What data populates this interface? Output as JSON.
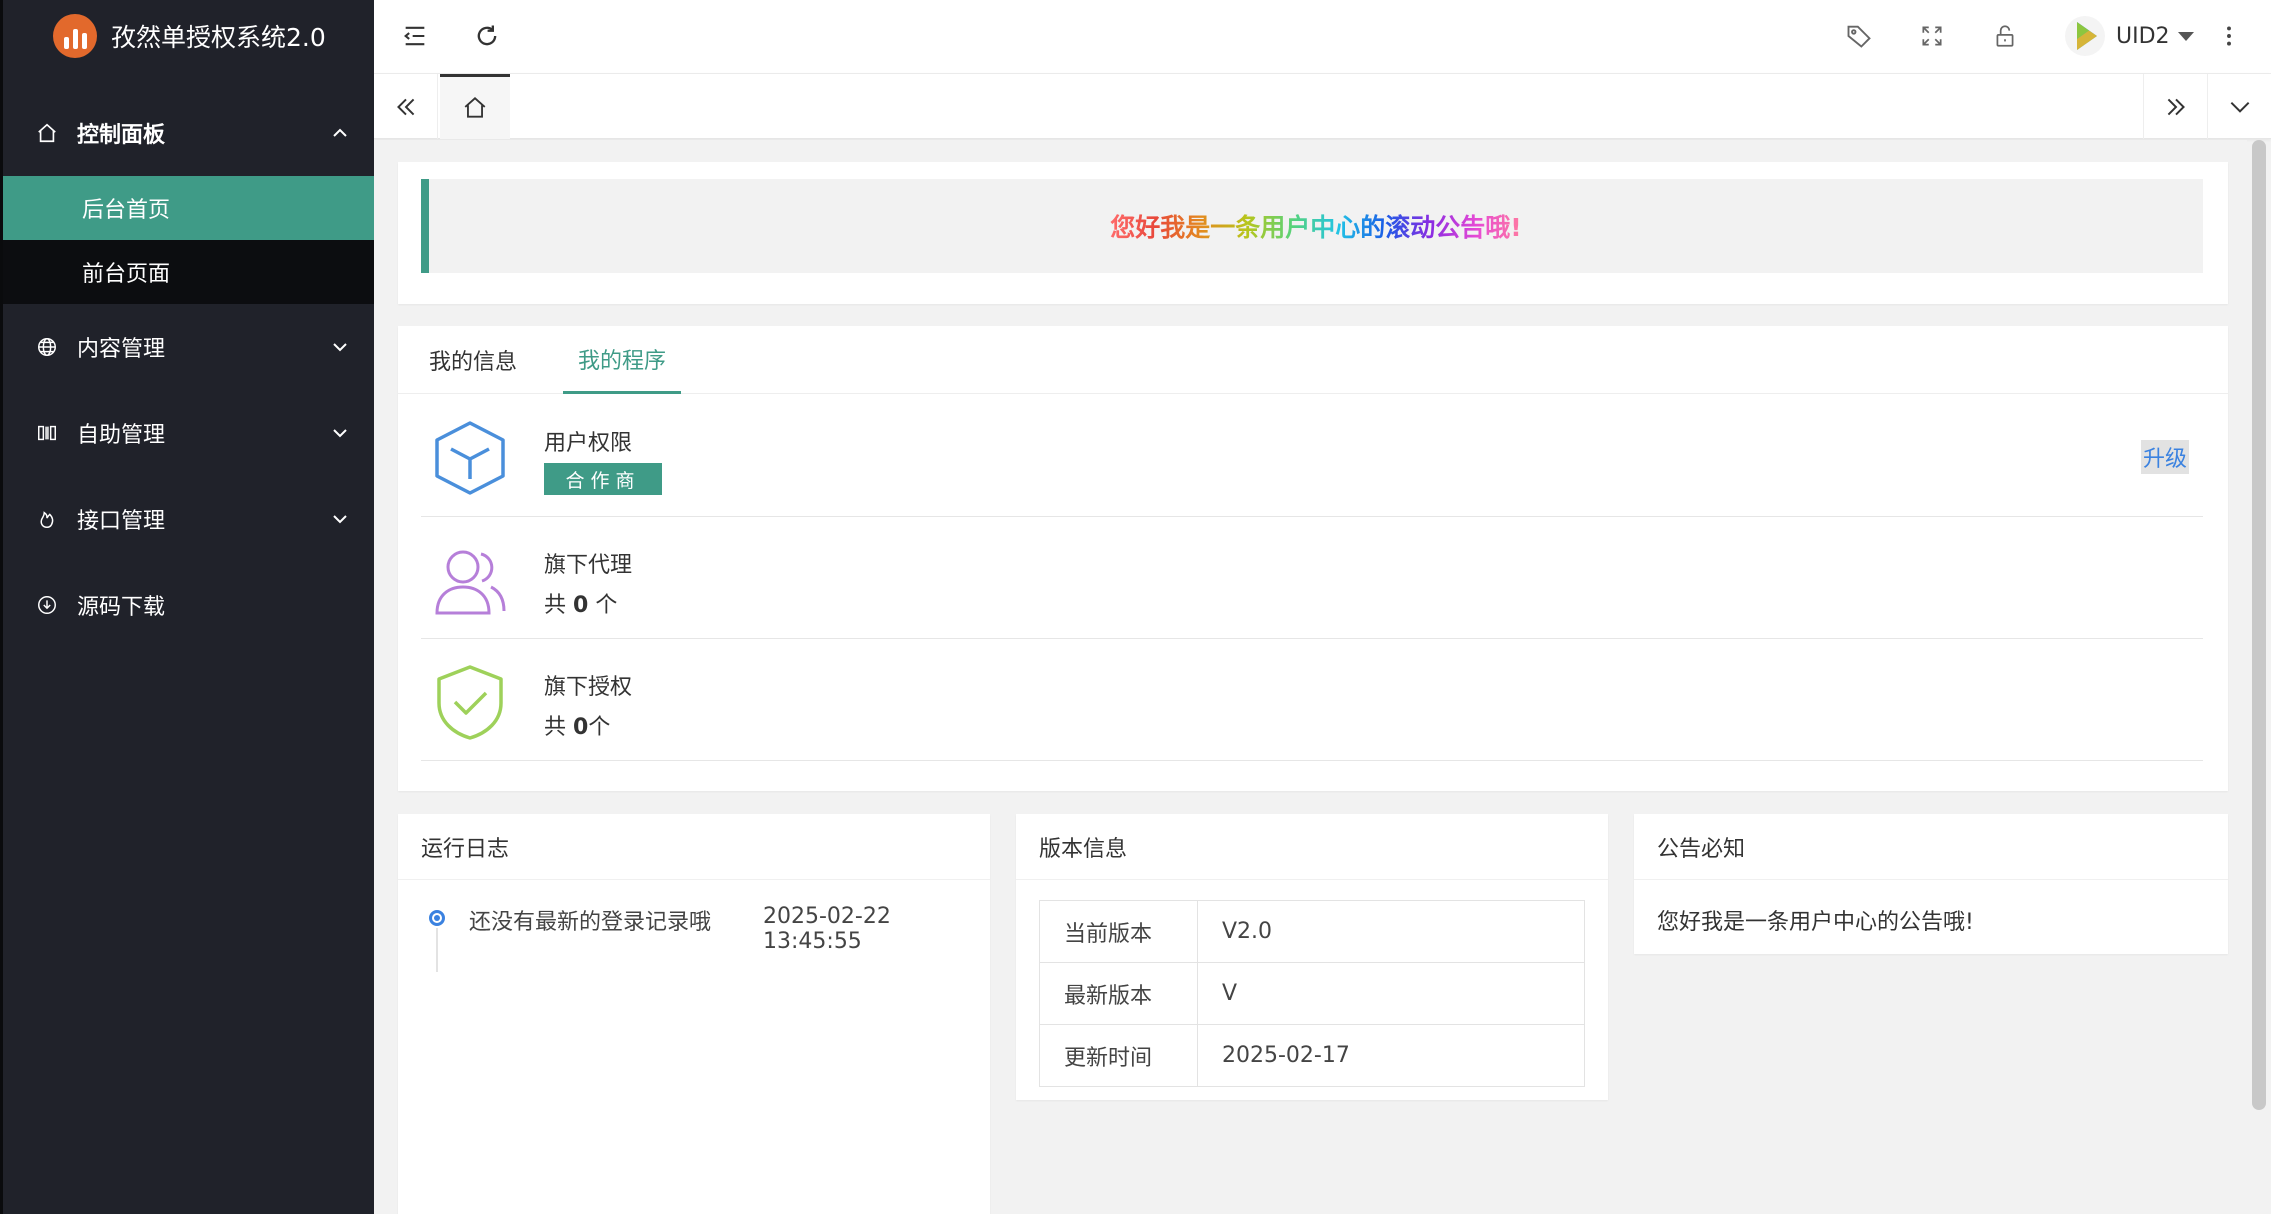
{
  "app": {
    "title": "孜然单授权系统2.0"
  },
  "sidebar": {
    "items": [
      {
        "label": "控制面板",
        "icon": "home-icon",
        "open": true
      },
      {
        "label": "内容管理",
        "icon": "globe-icon"
      },
      {
        "label": "自助管理",
        "icon": "columns-icon"
      },
      {
        "label": "接口管理",
        "icon": "fire-icon"
      },
      {
        "label": "源码下载",
        "icon": "download-circle-icon"
      }
    ],
    "sub_items": [
      {
        "label": "后台首页",
        "active": true
      },
      {
        "label": "前台页面",
        "active": false
      }
    ]
  },
  "header": {
    "user_name": "UID2",
    "icons": [
      "menu-collapse-icon",
      "refresh-icon",
      "tag-icon",
      "fullscreen-icon",
      "lock-icon",
      "more-vertical-icon"
    ]
  },
  "notice": {
    "marquee": "您好我是一条用户中心的滚动公告哦!"
  },
  "tabs": [
    {
      "label": "我的信息",
      "active": false
    },
    {
      "label": "我的程序",
      "active": true
    }
  ],
  "programs": {
    "permission": {
      "title": "用户权限",
      "badge": "合作商",
      "action": "升级"
    },
    "agents": {
      "title": "旗下代理",
      "prefix": "共",
      "count": "0",
      "suffix": "个"
    },
    "licenses": {
      "title": "旗下授权",
      "prefix": "共",
      "count": "0",
      "suffix": "个"
    }
  },
  "log": {
    "title": "运行日志",
    "entry_text": "还没有最新的登录记录哦",
    "entry_time": "2025-02-22 13:45:55"
  },
  "version": {
    "title": "版本信息",
    "rows": [
      {
        "key": "当前版本",
        "value": "V2.0"
      },
      {
        "key": "最新版本",
        "value": "V"
      },
      {
        "key": "更新时间",
        "value": "2025-02-17"
      }
    ]
  },
  "announcement": {
    "title": "公告必知",
    "text": "您好我是一条用户中心的公告哦!"
  },
  "colors": {
    "sidebar_bg": "#20222a",
    "accent": "#3f9b87",
    "link": "#3b82e0",
    "logo": "#e2692c"
  }
}
